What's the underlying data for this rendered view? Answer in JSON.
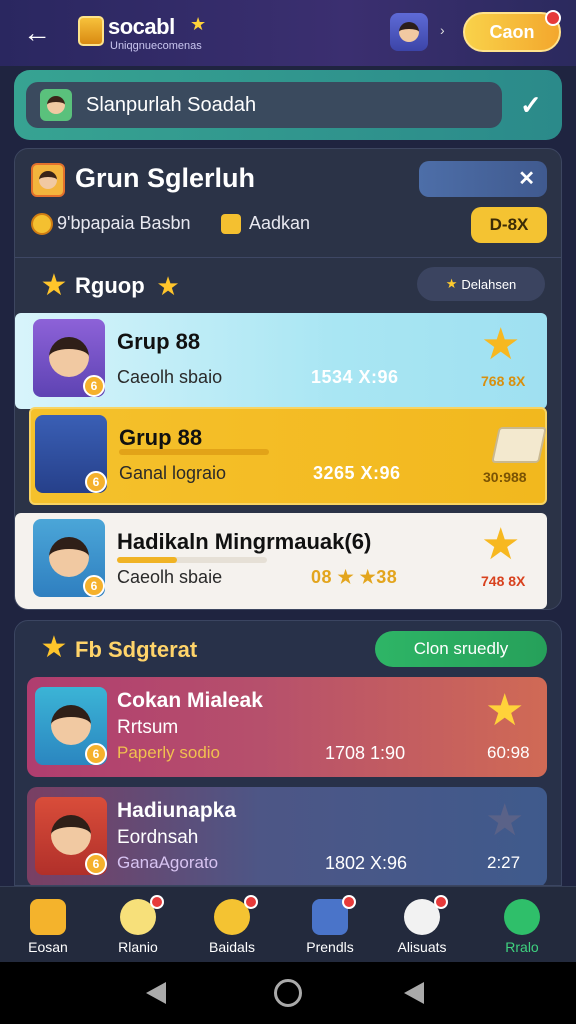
{
  "header": {
    "back_icon": "arrow-left-icon",
    "title": "socabl",
    "subtitle": "Uniqgnuecomenas",
    "coin_label": "Caon"
  },
  "search": {
    "value": "Slanpurlah Soadah"
  },
  "group": {
    "title": "Grun Sglerluh",
    "sub_label_1": "9'bpapaia Basbn",
    "sub_label_2": "Aadkan",
    "chip_label": "D-8X",
    "section_title": "Rguop",
    "sort_label": "Delahsen",
    "rows": [
      {
        "name": "Grup 88",
        "subtitle": "Caeolh sbaio",
        "stat": "1534  X:96",
        "score": "768 8X"
      },
      {
        "name": "Grup 88",
        "subtitle": "Ganal lograio",
        "stat": "3265  X:96",
        "score": "30:988"
      },
      {
        "name": "Hadikaln Mingrmauak(6)",
        "subtitle": "Caeolh sbaie",
        "stat": "08 ★ ★38",
        "score": "748 8X"
      }
    ]
  },
  "featured": {
    "section_title": "Fb Sdgterat",
    "button_label": "Clon sruedly",
    "rows": [
      {
        "name": "Cokan Mialeak",
        "line2": "Rrtsum",
        "subtitle": "Paperly sodio",
        "stat": "1708  1:90",
        "score": "60:98"
      },
      {
        "name": "Hadiunapka",
        "line2": "Eordnsah",
        "subtitle": "GanaAgorato",
        "stat": "1802  X:96",
        "score": "2:27"
      }
    ]
  },
  "nav": {
    "items": [
      {
        "label": "Eosan",
        "icon": "home-icon"
      },
      {
        "label": "Rlanio",
        "icon": "egg-icon"
      },
      {
        "label": "Baidals",
        "icon": "coin-icon"
      },
      {
        "label": "Prendls",
        "icon": "gift-icon"
      },
      {
        "label": "Alisuats",
        "icon": "chart-icon"
      },
      {
        "label": "Rralo",
        "icon": "profile-icon"
      }
    ]
  },
  "colors": {
    "accent_green": "#2eb566",
    "gold": "#f4c332",
    "header_bg": "#2a2760"
  }
}
